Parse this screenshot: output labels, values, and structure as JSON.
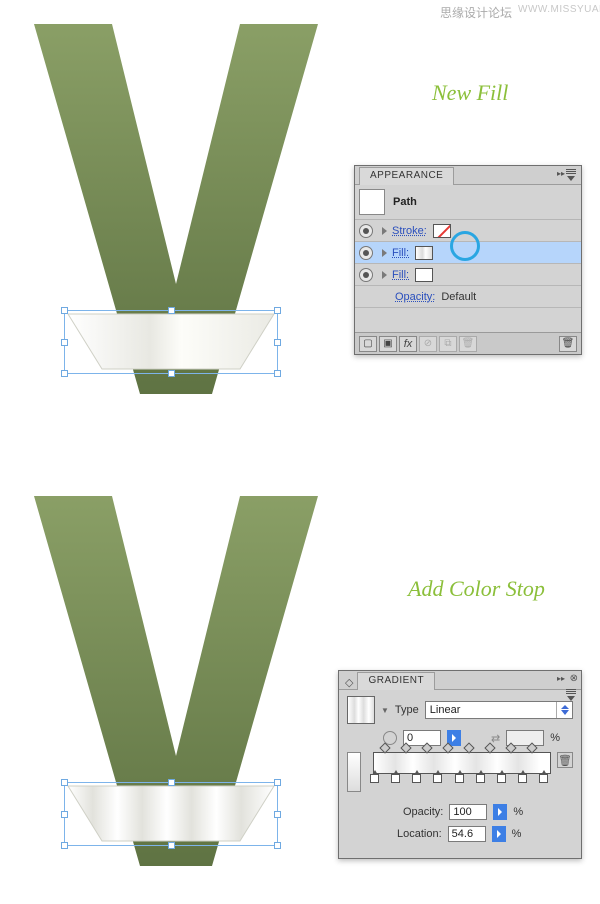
{
  "watermark": {
    "cn": "思缘设计论坛",
    "en": "WWW.MISSYUAN.COM"
  },
  "annotations": {
    "new_fill": "New Fill",
    "add_color_stop": "Add Color Stop"
  },
  "appearance": {
    "title": "APPEARANCE",
    "object_label": "Path",
    "rows": {
      "stroke_label": "Stroke:",
      "fill_label": "Fill:",
      "opacity_label": "Opacity:",
      "opacity_value": "Default"
    },
    "footer_fx": "fx"
  },
  "gradient": {
    "title": "GRADIENT",
    "type_label": "Type",
    "type_value": "Linear",
    "angle_value": "0",
    "ratio_symbol": "%",
    "opacity_label": "Opacity:",
    "opacity_value": "100",
    "location_label": "Location:",
    "location_value": "54.6",
    "stops_pct": [
      0,
      12,
      24,
      36,
      48,
      60,
      72,
      84,
      96
    ],
    "dia_pct": [
      6,
      18,
      30,
      42,
      54,
      66,
      78,
      90
    ]
  }
}
